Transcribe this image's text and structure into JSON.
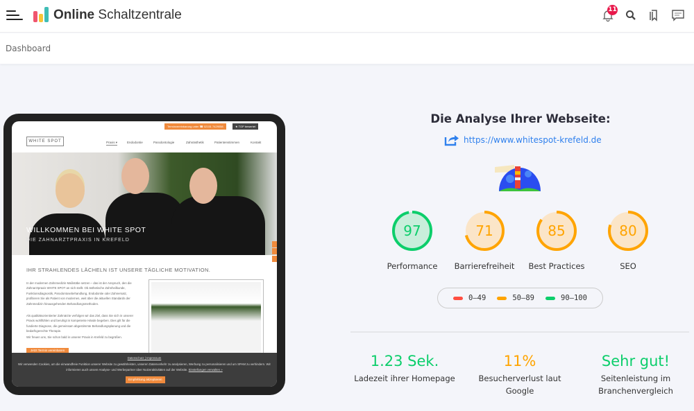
{
  "header": {
    "brand_bold": "Online",
    "brand_rest": " Schaltzentrale",
    "notification_count": "11",
    "icons": [
      "menu-icon",
      "bell-icon",
      "search-icon",
      "bookmark-icon",
      "chat-icon"
    ]
  },
  "breadcrumb": {
    "current": "Dashboard"
  },
  "preview": {
    "top_cta": "Terminvereinbarung unter  ☎ 02151 7429058",
    "top_rated": "★ TOP bewertet",
    "logo": "WHITE SPOT",
    "nav": [
      "Praxis ▾",
      "Endodontie",
      "Parodontologie",
      "Zahnästhetik",
      "Patientenstimmen",
      "Kontakt"
    ],
    "hero_title": "WILLKOMMEN BEI WHITE SPOT",
    "hero_sub": "DIE ZAHNARZTPRAXIS IN KREFELD",
    "section_title": "IHR STRAHLENDES LÄCHELN IST UNSERE TÄGLICHE MOTIVATION.",
    "para1": "In der modernen Zahnmedizin Maßstäbe setzen – das ist der Anspruch, den die Zahnarztpraxis WHITE SPOT an sich stellt. Ob ästhetische Zahnheilkunde, Funktionsdiagnostik, Parodontosebehandlung, Endodontie oder Zahnersatz, profitieren Sie als Patient von modernen, weit über die aktuellen Standards der Zahnmedizin hinausgehenden Behandlungsmethoden.",
    "para2": "Als qualitätsorientierter Zahnärzte verfolgen wir das Ziel, dass Sie sich in unserer Praxis wohlfühlen und beruhigt in kompetente Hände begeben. Dies gilt für die fundierte Diagnose, die gemeinsam abgestimmte Behandlungsplanung und die bedarfsgerechte Therapie.",
    "para3": "Wir freuen uns, Sie schon bald in unserer Praxis in Krefeld zu begrüßen.",
    "cta": "Jetzt Termin vereinbaren",
    "cookie_links": "Datenschutz | Impressum",
    "cookie_text": "Wir verwenden Cookies, um die einwandfreie Funktion unserer Website zu gewährleisten, unseren Datenverkehr zu analysieren, Werbung zu personalisieren und um SPAM zu verhindern. Wir informieren auch unsere Analyse- und Werbepartner über Nutzeraktivitäten auf der Website.",
    "cookie_settings": "Einstellungen verwalten »",
    "cookie_accept": "Empfehlung akzeptieren"
  },
  "analysis": {
    "title": "Die Analyse Ihrer Webseite:",
    "url": "https://www.whitespot-krefeld.de",
    "scores": [
      {
        "label": "Performance",
        "value": 97,
        "color": "#0cce6b",
        "bg": "#c8eedb"
      },
      {
        "label": "Barrierefreiheit",
        "value": 71,
        "color": "#ffa400",
        "bg": "#fbe5c8"
      },
      {
        "label": "Best Practices",
        "value": 85,
        "color": "#ffa400",
        "bg": "#fbe5c8"
      },
      {
        "label": "SEO",
        "value": 80,
        "color": "#ffa400",
        "bg": "#fbe5c8"
      }
    ],
    "legend": [
      {
        "label": "0–49",
        "color": "#ff4e42"
      },
      {
        "label": "50–89",
        "color": "#ffa400"
      },
      {
        "label": "90–100",
        "color": "#0cce6b"
      }
    ],
    "stats": [
      {
        "value": "1.23 Sek.",
        "label": "Ladezeit ihrer Homepage",
        "color": "#0cce6b"
      },
      {
        "value": "11%",
        "label": "Besucherverlust laut Google",
        "color": "#ffa400"
      },
      {
        "value": "Sehr gut!",
        "label": "Seitenleistung im Branchenvergleich",
        "color": "#0cce6b"
      }
    ]
  }
}
